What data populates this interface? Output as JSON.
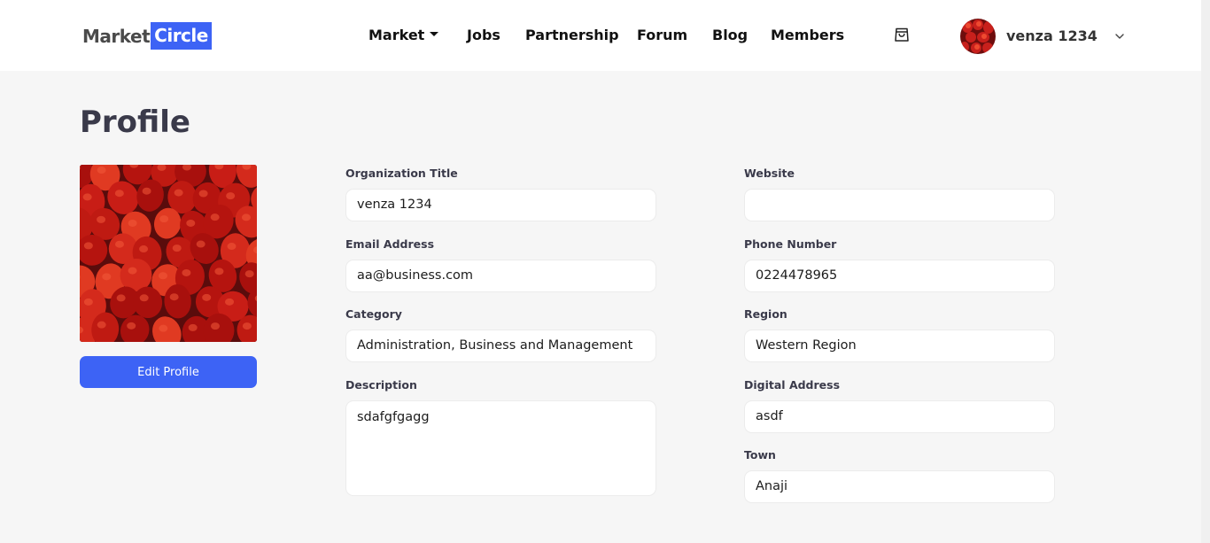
{
  "brand": {
    "part1": "Market",
    "part2": "Circle",
    "accent": "#3d63f5"
  },
  "nav": {
    "items": [
      {
        "label": "Market",
        "has_dropdown": true
      },
      {
        "label": "Jobs"
      },
      {
        "label": "Partnership"
      },
      {
        "label": "Forum"
      },
      {
        "label": "Blog"
      },
      {
        "label": "Members"
      }
    ],
    "cart_icon": "shopping-bag-icon",
    "user": {
      "name": "venza 1234",
      "menu_icon": "chevron-down-icon"
    }
  },
  "page": {
    "title": "Profile"
  },
  "profile": {
    "photo": "strawberries",
    "edit_label": "Edit Profile"
  },
  "form": {
    "org_title": {
      "label": "Organization Title",
      "value": "venza 1234"
    },
    "email": {
      "label": "Email Address",
      "value": "aa@business.com"
    },
    "category": {
      "label": "Category",
      "value": "Administration, Business and Management"
    },
    "description": {
      "label": "Description",
      "value": "sdafgfgagg"
    },
    "website": {
      "label": "Website",
      "value": ""
    },
    "phone": {
      "label": "Phone Number",
      "value": "0224478965"
    },
    "region": {
      "label": "Region",
      "value": "Western Region"
    },
    "digital_address": {
      "label": "Digital Address",
      "value": "asdf"
    },
    "town": {
      "label": "Town",
      "value": "Anaji"
    }
  }
}
